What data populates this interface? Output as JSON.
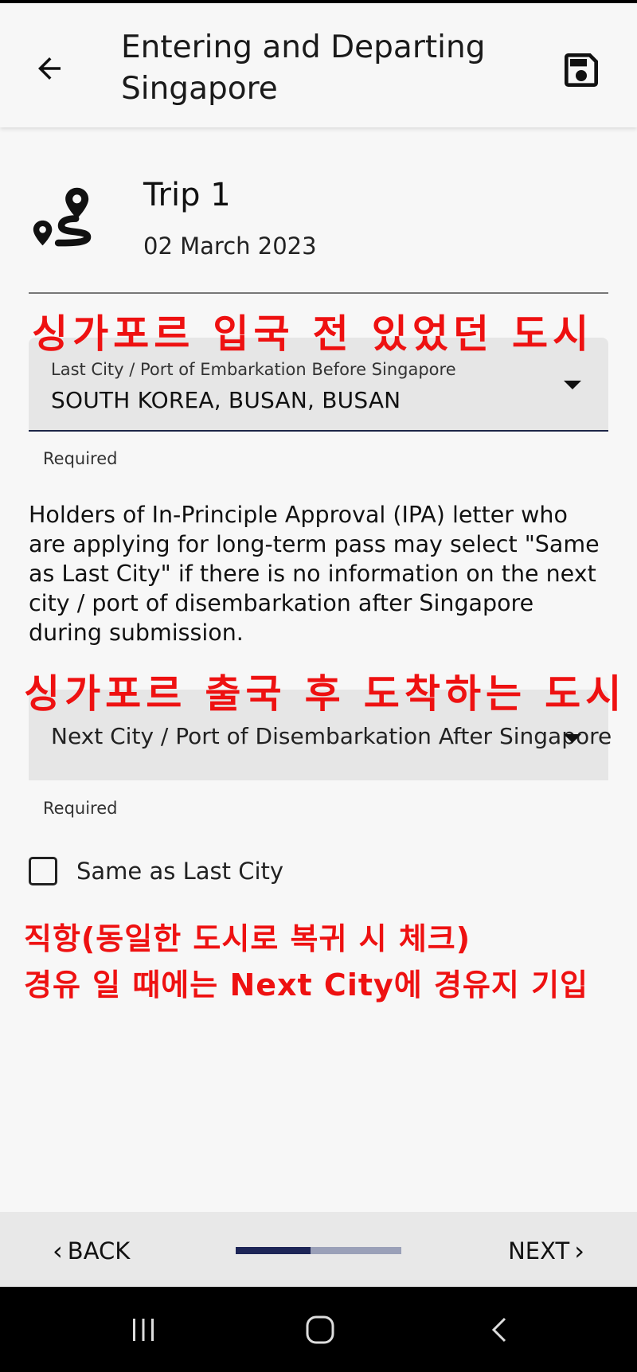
{
  "appbar": {
    "title": "Entering and Departing Singapore",
    "back_icon": "arrow-left-icon",
    "save_icon": "floppy-disk-icon"
  },
  "trip": {
    "icon": "route-icon",
    "name": "Trip 1",
    "date": "02 March 2023"
  },
  "annotations": {
    "last_city": "싱가포르 입국 전 있었던 도시",
    "next_city": "싱가포르 출국 후 도착하는 도시",
    "note_line1": "직항(동일한 도시로 복귀 시 체크)",
    "note_line2": "경유 일 때에는 Next City에 경유지 기입",
    "color": "#ee1111"
  },
  "last_city_field": {
    "label": "Last City / Port of Embarkation Before Singapore",
    "value": "SOUTH KOREA, BUSAN, BUSAN",
    "helper": "Required"
  },
  "info_text": "Holders of In-Principle Approval (IPA) letter who are applying for long-term pass may select \"Same as Last City\" if there is no information on the next city / port of disembarkation after Singapore during submission.",
  "next_city_field": {
    "placeholder": "Next City / Port of Disembarkation After Singapore",
    "value": "",
    "helper": "Required"
  },
  "same_as_last_city": {
    "label": "Same as Last City",
    "checked": false
  },
  "footer": {
    "back_label": "BACK",
    "next_label": "NEXT",
    "progress": 0.45,
    "progress_color": "#1d2557",
    "track_color": "#9aa0b8"
  },
  "system_nav": {
    "recents_icon": "recent-apps-icon",
    "home_icon": "home-icon",
    "back_icon": "system-back-icon"
  }
}
